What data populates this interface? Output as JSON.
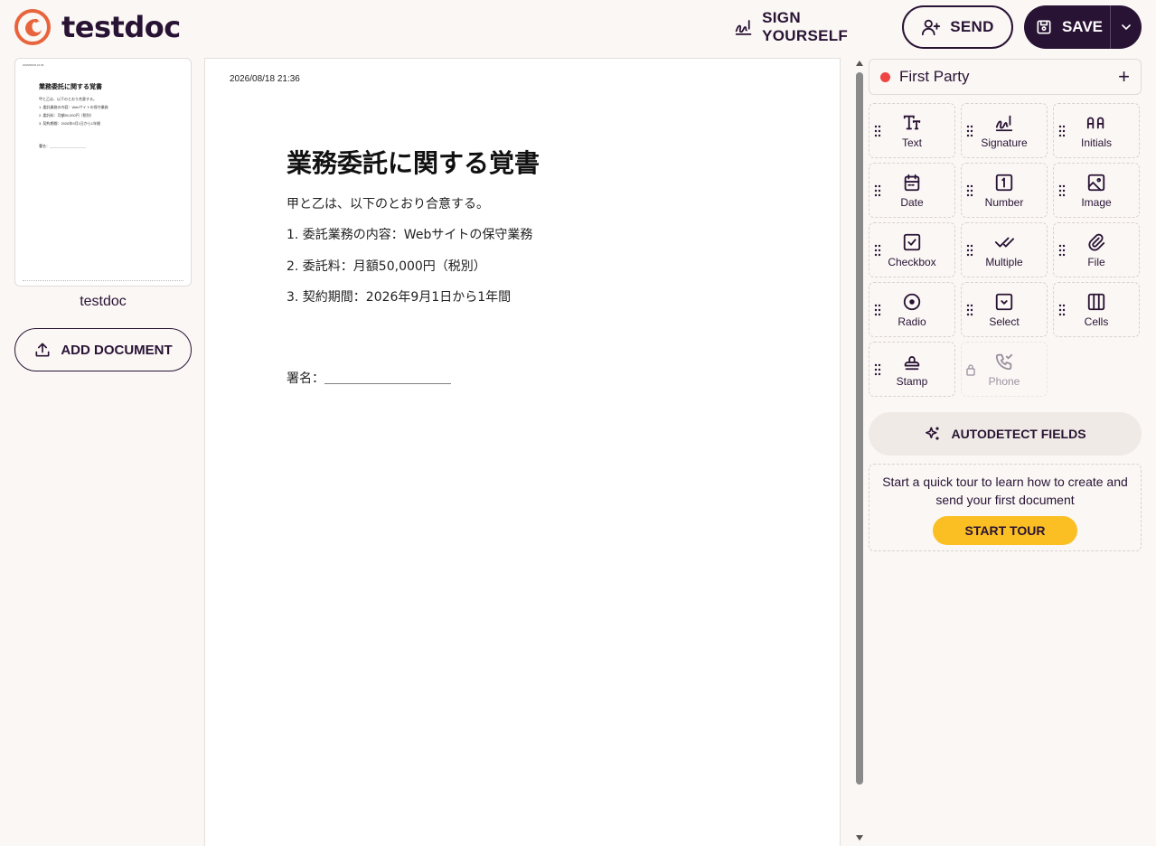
{
  "app": {
    "name": "testdoc"
  },
  "header": {
    "sign_yourself_label": "SIGN YOURSELF",
    "send_label": "SEND",
    "save_label": "SAVE"
  },
  "sidebar": {
    "document_name": "testdoc",
    "add_document_label": "ADD DOCUMENT"
  },
  "document": {
    "timestamp": "2026/08/18 21:36",
    "title": "業務委託に関する覚書",
    "lines": [
      "甲と乙は、以下のとおり合意する。",
      "1. 委託業務の内容：Webサイトの保守業務",
      "2. 委託料：月額50,000円（税別）",
      "3. 契約期間：2026年9月1日から1年間"
    ],
    "signature_line": "署名：＿＿＿＿＿＿＿＿＿＿"
  },
  "panel": {
    "party_name": "First Party",
    "party_color": "#ef4444",
    "fields": [
      {
        "label": "Text",
        "icon": "text-icon"
      },
      {
        "label": "Signature",
        "icon": "signature-icon"
      },
      {
        "label": "Initials",
        "icon": "initials-icon"
      },
      {
        "label": "Date",
        "icon": "calendar-icon"
      },
      {
        "label": "Number",
        "icon": "number-icon"
      },
      {
        "label": "Image",
        "icon": "image-icon"
      },
      {
        "label": "Checkbox",
        "icon": "checkbox-icon"
      },
      {
        "label": "Multiple",
        "icon": "multiple-check-icon"
      },
      {
        "label": "File",
        "icon": "paperclip-icon"
      },
      {
        "label": "Radio",
        "icon": "radio-icon"
      },
      {
        "label": "Select",
        "icon": "select-icon"
      },
      {
        "label": "Cells",
        "icon": "cells-icon"
      },
      {
        "label": "Stamp",
        "icon": "stamp-icon"
      },
      {
        "label": "Phone",
        "icon": "phone-icon",
        "locked": true
      }
    ],
    "autodetect_label": "AUTODETECT FIELDS",
    "tour_text": "Start a quick tour to learn how to create and send your first document",
    "tour_button_label": "START TOUR",
    "tour_button_color": "#fbbf24"
  }
}
